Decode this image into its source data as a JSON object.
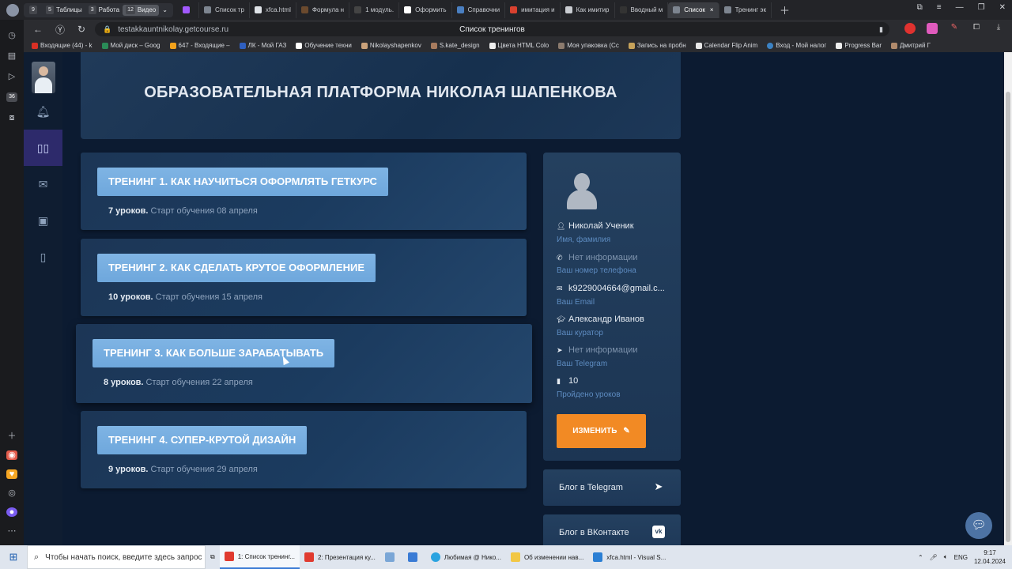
{
  "browser": {
    "workspaces": [
      {
        "num": "9",
        "label": ""
      },
      {
        "num": "5",
        "label": "Таблицы"
      },
      {
        "num": "3",
        "label": "Работа"
      },
      {
        "num": "12",
        "label": "Видео"
      }
    ],
    "tabs": [
      {
        "label": "Список тр"
      },
      {
        "label": "xfca.html"
      },
      {
        "label": "Формула н"
      },
      {
        "label": "1 модуль."
      },
      {
        "label": "Оформить"
      },
      {
        "label": "Справочни"
      },
      {
        "label": "имитация и"
      },
      {
        "label": "Как имитир"
      },
      {
        "label": "Вводный м"
      },
      {
        "label": "Список"
      },
      {
        "label": "Тренинг эк"
      }
    ],
    "url": "testakkauntnikolay.getcourse.ru",
    "page_title": "Список тренингов",
    "bookmarks": [
      "Входящие (44) - k",
      "Мой диск – Goog",
      "647 - Входящие –",
      "ЛК - Мой ГАЗ",
      "Обучение техни",
      "Nikolayshapenkov",
      "S.kate_design",
      "Цвета HTML Colo",
      "Моя упаковка (Cc",
      "Запись на пробн",
      "Calendar Flip Anim",
      "Вход - Мой налог",
      "Progress Bar",
      "Дмитрий Г"
    ],
    "sidebar_badge": "36"
  },
  "header": {
    "title": "ОБРАЗОВАТЕЛЬНАЯ ПЛАТФОРМА НИКОЛАЯ ШАПЕНКОВА"
  },
  "trainings": [
    {
      "title": "ТРЕНИНГ 1. КАК НАУЧИТЬСЯ ОФОРМЛЯТЬ ГЕТКУРС",
      "lessons": "7 уроков.",
      "start": "Старт обучения 08 апреля"
    },
    {
      "title": "ТРЕНИНГ 2. КАК СДЕЛАТЬ КРУТОЕ ОФОРМЛЕНИЕ",
      "lessons": "10 уроков.",
      "start": "Старт обучения 15 апреля"
    },
    {
      "title": "ТРЕНИНГ 3. КАК БОЛЬШЕ ЗАРАБАТЫВАТЬ",
      "lessons": "8 уроков.",
      "start": "Старт обучения 22 апреля"
    },
    {
      "title": "ТРЕНИНГ 4. СУПЕР-КРУТОЙ ДИЗАЙН",
      "lessons": "9 уроков.",
      "start": "Старт обучения 29 апреля"
    }
  ],
  "profile": {
    "name": "Николай Ученик",
    "name_label": "Имя, фамилия",
    "phone": "Нет информации",
    "phone_label": "Ваш номер телефона",
    "email": "k9229004664@gmail.c...",
    "email_label": "Ваш Email",
    "curator": "Александр Иванов",
    "curator_label": "Ваш куратор",
    "telegram": "Нет информации",
    "telegram_label": "Ваш Telegram",
    "lessons_done": "10",
    "lessons_done_label": "Пройдено уроков",
    "edit_button": "ИЗМЕНИТЬ"
  },
  "social": [
    {
      "label": "Блог в Telegram",
      "icon": "telegram-icon"
    },
    {
      "label": "Блог в ВКонтакте",
      "icon": "vk-icon"
    }
  ],
  "taskbar": {
    "search_placeholder": "Чтобы начать поиск, введите здесь запрос",
    "apps": [
      "1: Список тренинг...",
      "2: Презентация ку...",
      "Любимая @ Нико...",
      "Об изменении нав...",
      "xfca.html - Visual S..."
    ],
    "lang": "ENG",
    "time": "9:17",
    "date": "12.04.2024"
  },
  "colors": {
    "accent_orange": "#f28a24",
    "pill_blue": "#7fb4e4",
    "nav_active": "#2d2a6b"
  }
}
